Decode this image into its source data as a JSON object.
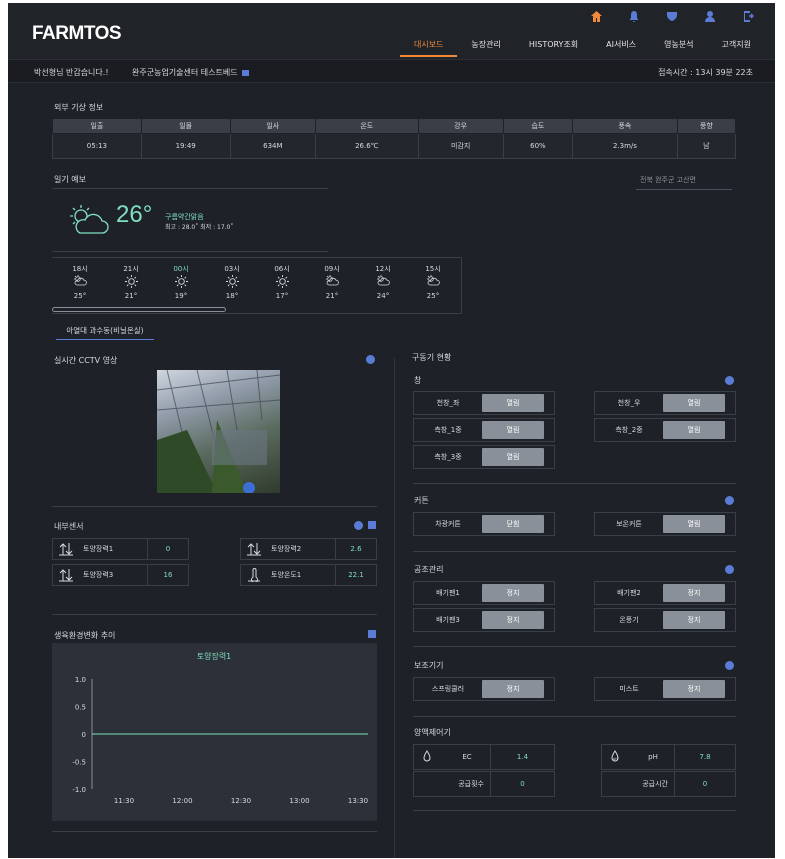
{
  "app": {
    "logo": "FARMTOS"
  },
  "nav": [
    "대시보드",
    "농장관리",
    "HISTORY조회",
    "AI서비스",
    "영농분석",
    "고객지원"
  ],
  "top_icons": [
    "home-icon",
    "bell-icon",
    "shield-icon",
    "user-icon",
    "logout-icon"
  ],
  "infobar": {
    "greeting": "박선형님 반갑습니다.!",
    "farm": "완주군농업기술센터 테스트베드",
    "session": "접속시간 : 13시 39분 22초"
  },
  "weather": {
    "title": "외부 기상 정보",
    "headers": [
      "일출",
      "일몰",
      "일사",
      "온도",
      "강우",
      "습도",
      "풍속",
      "풍향"
    ],
    "values": [
      "05:13",
      "19:49",
      "634M",
      "26.6℃",
      "미감지",
      "60%",
      "2.3m/s",
      "남"
    ]
  },
  "forecast": {
    "title": "일기 예보",
    "location": "전북 완주군 고산면",
    "temp": "26°",
    "condition": "구름약간맑음",
    "minmax": "최고 : 28.0˚ 최저 : 17.0˚",
    "hours": [
      {
        "time": "18시",
        "icon": "partly-cloudy",
        "temp": "25°"
      },
      {
        "time": "21시",
        "icon": "sunny",
        "temp": "21°"
      },
      {
        "time": "00시",
        "icon": "sunny",
        "temp": "19°",
        "current": true
      },
      {
        "time": "03시",
        "icon": "sunny",
        "temp": "18°"
      },
      {
        "time": "06시",
        "icon": "sunny",
        "temp": "17°"
      },
      {
        "time": "09시",
        "icon": "partly-cloudy",
        "temp": "21°"
      },
      {
        "time": "12시",
        "icon": "partly-cloudy",
        "temp": "24°"
      },
      {
        "time": "15시",
        "icon": "partly-cloudy",
        "temp": "25°"
      }
    ]
  },
  "tab": "아열대 과수동(비닐온실)",
  "cctv": {
    "title": "실시간 CCTV 영상"
  },
  "sensors": {
    "title": "내부센서",
    "items": [
      {
        "name": "토양장력1",
        "value": "0"
      },
      {
        "name": "토양장력2",
        "value": "2.6"
      },
      {
        "name": "토양장력3",
        "value": "16"
      },
      {
        "name": "토양온도1",
        "value": "22.1"
      }
    ]
  },
  "trend": {
    "title": "생육환경변화 추이"
  },
  "chart_data": {
    "type": "line",
    "title": "토양장력1",
    "x": [
      "11:30",
      "12:00",
      "12:30",
      "13:00",
      "13:30"
    ],
    "series": [
      {
        "values": [
          0,
          0,
          0,
          0,
          0
        ]
      }
    ],
    "ylim": [
      -1.0,
      1.0
    ],
    "yticks": [
      "1.0",
      "0.5",
      "0",
      "-0.5",
      "-1.0"
    ]
  },
  "drive": {
    "title": "구동기 현황",
    "groups": [
      {
        "title": "창",
        "items": [
          {
            "name": "천창_좌",
            "state": "열림"
          },
          {
            "name": "천창_우",
            "state": "열림"
          },
          {
            "name": "측창_1중",
            "state": "열림"
          },
          {
            "name": "측창_2중",
            "state": "열림"
          },
          {
            "name": "측창_3중",
            "state": "열림"
          }
        ]
      },
      {
        "title": "커튼",
        "items": [
          {
            "name": "차광커튼",
            "state": "닫힘"
          },
          {
            "name": "보온커튼",
            "state": "열림"
          }
        ]
      },
      {
        "title": "공조관리",
        "items": [
          {
            "name": "배기팬1",
            "state": "정지"
          },
          {
            "name": "배기팬2",
            "state": "정지"
          },
          {
            "name": "배기팬3",
            "state": "정지"
          },
          {
            "name": "온풍기",
            "state": "정지"
          }
        ]
      },
      {
        "title": "보조기기",
        "items": [
          {
            "name": "스프링쿨러",
            "state": "정지"
          },
          {
            "name": "미스트",
            "state": "정지"
          }
        ]
      }
    ]
  },
  "nutrient": {
    "title": "양액제어기",
    "ec_label": "EC",
    "ec": "1.4",
    "ph_label": "pH",
    "ph": "7.8",
    "count_label": "공급횟수",
    "count": "0",
    "time_label": "공급시간",
    "time": "0"
  }
}
